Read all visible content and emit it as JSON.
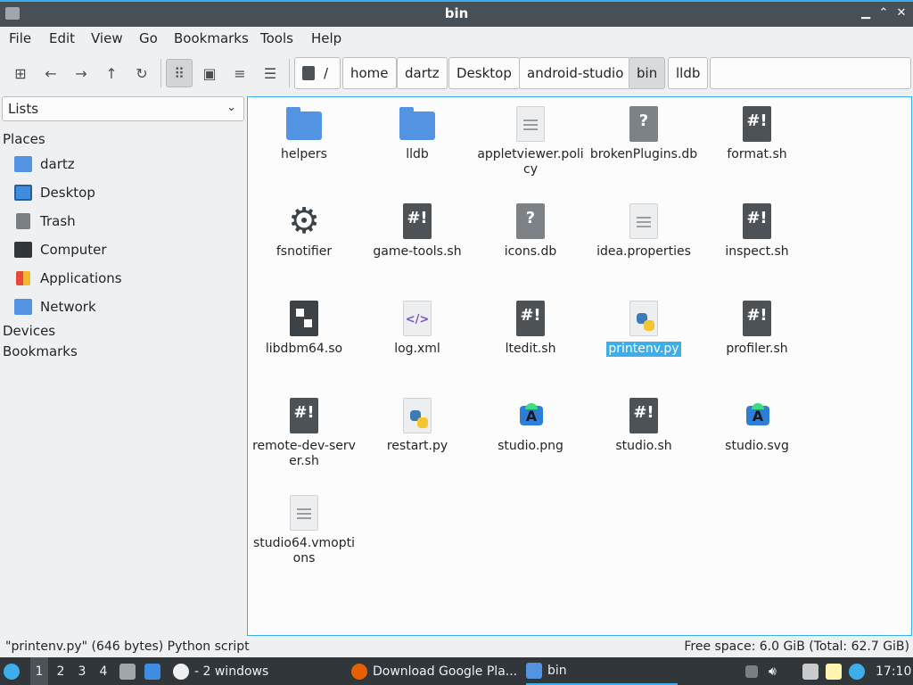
{
  "window": {
    "title": "bin",
    "min_glyph": "▁",
    "max_glyph": "⌃",
    "close_glyph": "✕"
  },
  "menu": [
    "File",
    "Edit",
    "View",
    "Go",
    "Bookmarks",
    "Tools",
    "Help"
  ],
  "toolbar": {
    "new_tab_glyph": "⊞",
    "back_glyph": "←",
    "forward_glyph": "→",
    "up_glyph": "↑",
    "reload_glyph": "↻",
    "icon_view_glyph": "⠿",
    "thumbnail_view_glyph": "▣",
    "compact_view_glyph": "≡",
    "detailed_view_glyph": "☰"
  },
  "breadcrumb": {
    "root": "/",
    "parts": [
      "home",
      "dartz",
      "Desktop",
      "android-studio",
      "bin",
      "lldb"
    ],
    "active": "bin"
  },
  "sidebar": {
    "mode": "Lists",
    "places_heading": "Places",
    "places": [
      {
        "label": "dartz",
        "icon": "home-folder-icon",
        "color": "#5294e2"
      },
      {
        "label": "Desktop",
        "icon": "desktop-icon",
        "color": "#3d8ee0"
      },
      {
        "label": "Trash",
        "icon": "trash-icon",
        "color": "#7a7f84"
      },
      {
        "label": "Computer",
        "icon": "computer-icon",
        "color": "#31363b"
      },
      {
        "label": "Applications",
        "icon": "applications-icon",
        "color": "#e64a3c"
      },
      {
        "label": "Network",
        "icon": "network-folder-icon",
        "color": "#5294e2"
      }
    ],
    "devices_heading": "Devices",
    "bookmarks_heading": "Bookmarks"
  },
  "files": [
    {
      "name": "helpers",
      "icon": "folder"
    },
    {
      "name": "lldb",
      "icon": "folder"
    },
    {
      "name": "appletviewer.policy",
      "icon": "text"
    },
    {
      "name": "brokenPlugins.db",
      "icon": "unknown"
    },
    {
      "name": "format.sh",
      "icon": "shell"
    },
    {
      "name": "fsnotifier",
      "icon": "executable"
    },
    {
      "name": "game-tools.sh",
      "icon": "shell"
    },
    {
      "name": "icons.db",
      "icon": "unknown"
    },
    {
      "name": "idea.properties",
      "icon": "text"
    },
    {
      "name": "inspect.sh",
      "icon": "shell"
    },
    {
      "name": "libdbm64.so",
      "icon": "library"
    },
    {
      "name": "log.xml",
      "icon": "xml"
    },
    {
      "name": "ltedit.sh",
      "icon": "shell"
    },
    {
      "name": "printenv.py",
      "icon": "python",
      "selected": true
    },
    {
      "name": "profiler.sh",
      "icon": "shell"
    },
    {
      "name": "remote-dev-server.sh",
      "icon": "shell"
    },
    {
      "name": "restart.py",
      "icon": "python"
    },
    {
      "name": "studio.png",
      "icon": "android-studio"
    },
    {
      "name": "studio.sh",
      "icon": "shell"
    },
    {
      "name": "studio.svg",
      "icon": "android-studio"
    },
    {
      "name": "studio64.vmoptions",
      "icon": "text"
    }
  ],
  "glyphs": {
    "shell": "#!",
    "unknown": "?",
    "xml": "</>",
    "gear": "⚙"
  },
  "status": {
    "left": "\"printenv.py\" (646 bytes) Python script",
    "right": "Free space: 6.0 GiB (Total: 62.7 GiB)"
  },
  "taskbar": {
    "workspaces": [
      "1",
      "2",
      "3",
      "4"
    ],
    "active_workspace": "1",
    "windows_group": "- 2 windows",
    "tasks": [
      "Download Google Pla...",
      "bin"
    ],
    "clock": "17:10"
  }
}
